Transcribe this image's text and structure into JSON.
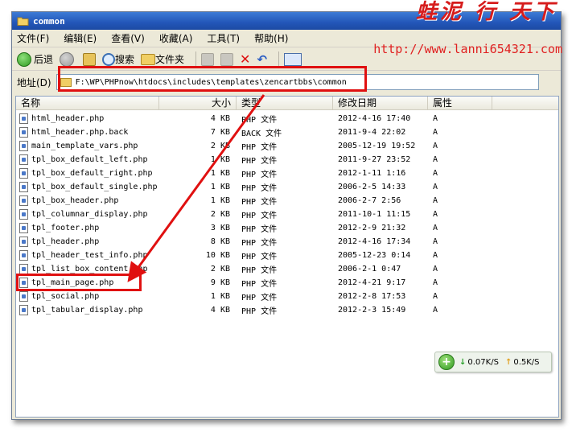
{
  "window": {
    "title": "common"
  },
  "watermark": {
    "name": "蛙泥 行 天下",
    "url": "http://www.lanni654321.com"
  },
  "menu": {
    "items": [
      "文件(F)",
      "编辑(E)",
      "查看(V)",
      "收藏(A)",
      "工具(T)",
      "帮助(H)"
    ]
  },
  "toolbar": {
    "back_label": "后退",
    "search_label": "搜索",
    "folders_label": "文件夹"
  },
  "address": {
    "label": "地址(D)",
    "path": "F:\\WP\\PHPnow\\htdocs\\includes\\templates\\zencartbbs\\common"
  },
  "columns": {
    "name": "名称",
    "size": "大小",
    "type": "类型",
    "date": "修改日期",
    "attr": "属性"
  },
  "files": [
    {
      "name": "html_header.php",
      "size": "4 KB",
      "type": "PHP 文件",
      "date": "2012-4-16 17:40",
      "attr": "A"
    },
    {
      "name": "html_header.php.back",
      "size": "7 KB",
      "type": "BACK 文件",
      "date": "2011-9-4 22:02",
      "attr": "A"
    },
    {
      "name": "main_template_vars.php",
      "size": "2 KB",
      "type": "PHP 文件",
      "date": "2005-12-19 19:52",
      "attr": "A"
    },
    {
      "name": "tpl_box_default_left.php",
      "size": "1 KB",
      "type": "PHP 文件",
      "date": "2011-9-27 23:52",
      "attr": "A"
    },
    {
      "name": "tpl_box_default_right.php",
      "size": "1 KB",
      "type": "PHP 文件",
      "date": "2012-1-11 1:16",
      "attr": "A"
    },
    {
      "name": "tpl_box_default_single.php",
      "size": "1 KB",
      "type": "PHP 文件",
      "date": "2006-2-5 14:33",
      "attr": "A"
    },
    {
      "name": "tpl_box_header.php",
      "size": "1 KB",
      "type": "PHP 文件",
      "date": "2006-2-7 2:56",
      "attr": "A"
    },
    {
      "name": "tpl_columnar_display.php",
      "size": "2 KB",
      "type": "PHP 文件",
      "date": "2011-10-1 11:15",
      "attr": "A"
    },
    {
      "name": "tpl_footer.php",
      "size": "3 KB",
      "type": "PHP 文件",
      "date": "2012-2-9 21:32",
      "attr": "A"
    },
    {
      "name": "tpl_header.php",
      "size": "8 KB",
      "type": "PHP 文件",
      "date": "2012-4-16 17:34",
      "attr": "A"
    },
    {
      "name": "tpl_header_test_info.php",
      "size": "10 KB",
      "type": "PHP 文件",
      "date": "2005-12-23 0:14",
      "attr": "A"
    },
    {
      "name": "tpl_list_box_content.php",
      "size": "2 KB",
      "type": "PHP 文件",
      "date": "2006-2-1 0:47",
      "attr": "A"
    },
    {
      "name": "tpl_main_page.php",
      "size": "9 KB",
      "type": "PHP 文件",
      "date": "2012-4-21 9:17",
      "attr": "A"
    },
    {
      "name": "tpl_social.php",
      "size": "1 KB",
      "type": "PHP 文件",
      "date": "2012-2-8 17:53",
      "attr": "A"
    },
    {
      "name": "tpl_tabular_display.php",
      "size": "4 KB",
      "type": "PHP 文件",
      "date": "2012-2-3 15:49",
      "attr": "A"
    }
  ],
  "speed": {
    "down": "0.07K/S",
    "up": "0.5K/S"
  },
  "colors": {
    "annotation": "#e01010",
    "titlebar": "#2356b8"
  }
}
